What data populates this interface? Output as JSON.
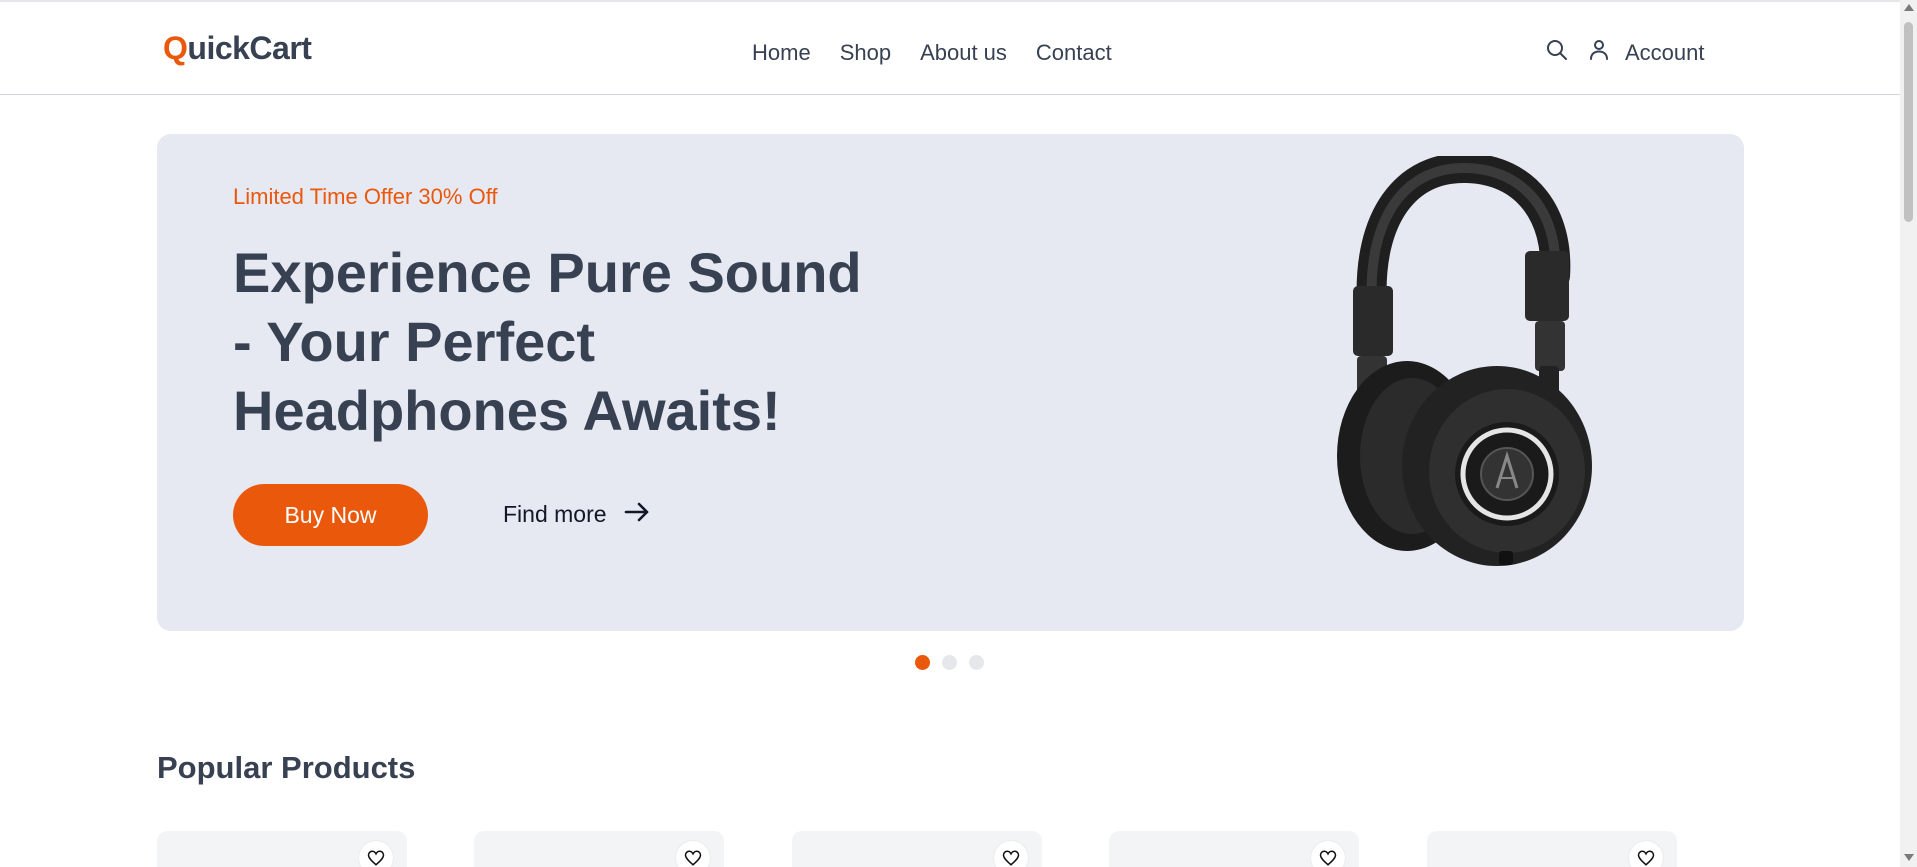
{
  "brand": {
    "logo_first": "Q",
    "logo_rest": "uickCart",
    "accent_color": "#ea580c"
  },
  "nav": {
    "items": [
      {
        "label": "Home"
      },
      {
        "label": "Shop"
      },
      {
        "label": "About us"
      },
      {
        "label": "Contact"
      }
    ]
  },
  "header": {
    "search_icon": "search-icon",
    "account_icon": "user-icon",
    "account_label": "Account"
  },
  "hero": {
    "offer_text": "Limited Time Offer 30% Off",
    "title": "Experience Pure Sound - Your Perfect Headphones Awaits!",
    "buy_label": "Buy Now",
    "find_more_label": "Find more",
    "image": "headphones",
    "background_color": "#e6e8f2"
  },
  "carousel": {
    "slides": 3,
    "active_index": 0
  },
  "products": {
    "section_title": "Popular Products",
    "favorite_icon": "heart-icon",
    "card_count": 5
  }
}
